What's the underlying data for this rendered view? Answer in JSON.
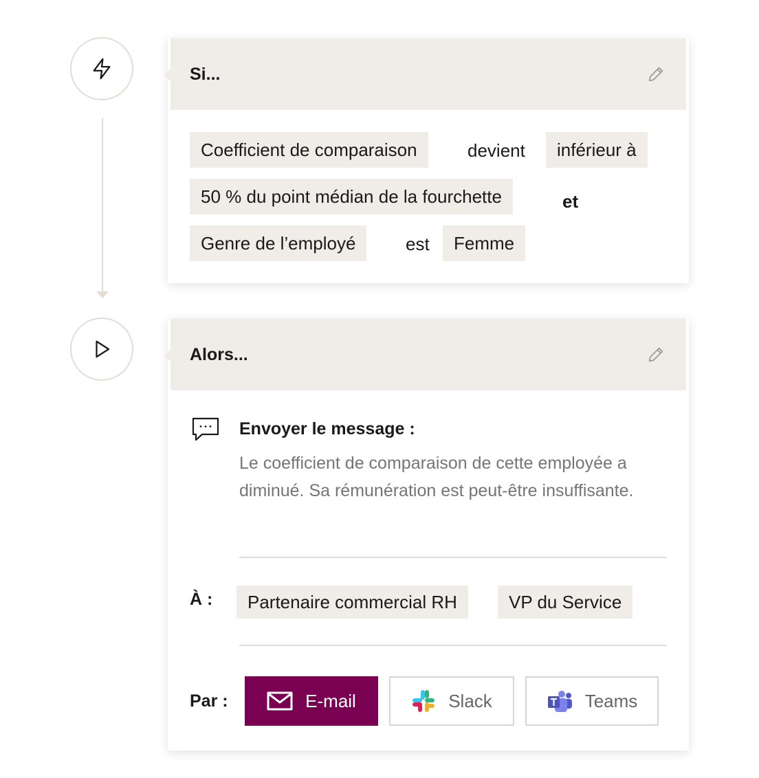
{
  "if_block": {
    "title": "Si...",
    "icon": "lightning-icon",
    "condition_1": {
      "field": "Coefficient de comparaison",
      "operator": "devient",
      "comparator": "inférieur à",
      "value": "50 % du point médian de la fourchette"
    },
    "conjunction": "et",
    "condition_2": {
      "field": "Genre de l’employé",
      "operator": "est",
      "value": "Femme"
    }
  },
  "then_block": {
    "title": "Alors...",
    "icon": "play-icon",
    "action_label": "Envoyer le message :",
    "message": "Le coefficient de comparaison de cette employée a diminué. Sa rémunération est peut-être insuffisante.",
    "to_label": "À :",
    "recipients": [
      "Partenaire commercial RH",
      "VP du Service"
    ],
    "via_label": "Par :",
    "channels": [
      {
        "label": "E-mail",
        "icon": "envelope-icon",
        "selected": true
      },
      {
        "label": "Slack",
        "icon": "slack-icon",
        "selected": false
      },
      {
        "label": "Teams",
        "icon": "teams-icon",
        "selected": false
      }
    ]
  },
  "colors": {
    "accent": "#7a0052",
    "chip_background": "#f0ece8",
    "header_background": "#f0ece8",
    "connector": "#e3ddd6"
  }
}
